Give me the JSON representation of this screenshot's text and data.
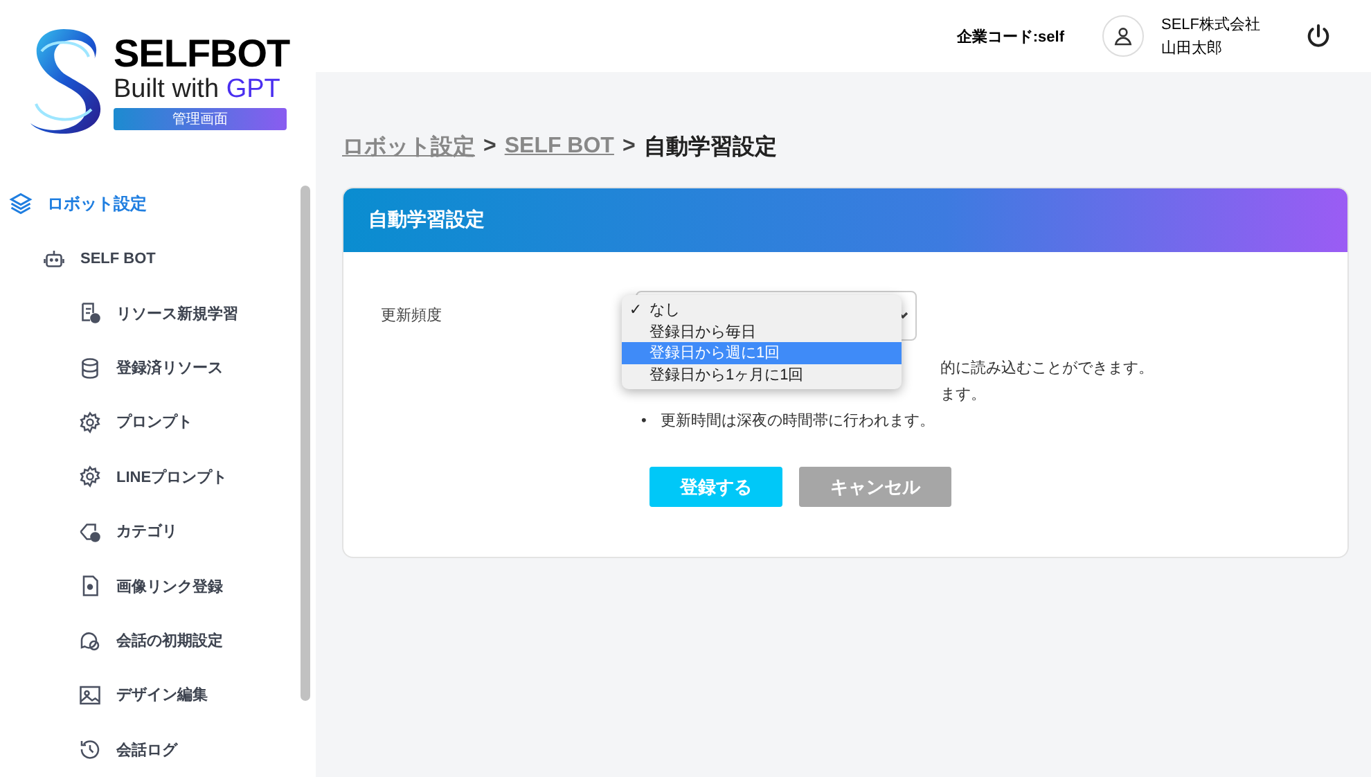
{
  "logo": {
    "title": "SELFBOT",
    "subtitle_prefix": "Built with ",
    "subtitle_accent": "GPT",
    "badge": "管理画面"
  },
  "header": {
    "company_code": "企業コード:self",
    "company": "SELF株式会社",
    "user": "山田太郎"
  },
  "sidebar": {
    "items": [
      {
        "label": "ロボット設定",
        "selected": true,
        "children": [
          {
            "label": "SELF BOT",
            "selected": false,
            "children": [
              {
                "label": "リソース新規学習",
                "selected": false
              },
              {
                "label": "登録済リソース",
                "selected": false
              },
              {
                "label": "プロンプト",
                "selected": false
              },
              {
                "label": "LINEプロンプト",
                "selected": false
              },
              {
                "label": "カテゴリ",
                "selected": false
              },
              {
                "label": "画像リンク登録",
                "selected": false
              },
              {
                "label": "会話の初期設定",
                "selected": false
              },
              {
                "label": "デザイン編集",
                "selected": false
              },
              {
                "label": "会話ログ",
                "selected": false
              }
            ]
          }
        ]
      }
    ]
  },
  "breadcrumb": [
    {
      "label": "ロボット設定",
      "kind": "link"
    },
    {
      "label": ">",
      "kind": "separator"
    },
    {
      "label": "SELF BOT",
      "kind": "link"
    },
    {
      "label": ">",
      "kind": "separator"
    },
    {
      "label": "自動学習設定",
      "kind": "current"
    }
  ],
  "card": {
    "title": "自動学習設定",
    "field_label": "更新頻度",
    "dropdown": [
      {
        "label": "なし",
        "selected": true,
        "highlighted": false
      },
      {
        "label": "登録日から毎日",
        "selected": false,
        "highlighted": false
      },
      {
        "label": "登録日から週に1回",
        "selected": false,
        "highlighted": true
      },
      {
        "label": "登録日から1ヶ月に1回",
        "selected": false,
        "highlighted": false
      }
    ],
    "check_mark": "✓",
    "notes": [
      {
        "text": "的に読み込むことができます。"
      },
      {
        "text": "ます。"
      },
      {
        "marker": "•",
        "text": "更新時間は深夜の時間帯に行われます。"
      }
    ],
    "buttons": [
      {
        "label": "登録する",
        "kind": "primary"
      },
      {
        "label": "キャンセル",
        "kind": "secondary"
      }
    ]
  }
}
